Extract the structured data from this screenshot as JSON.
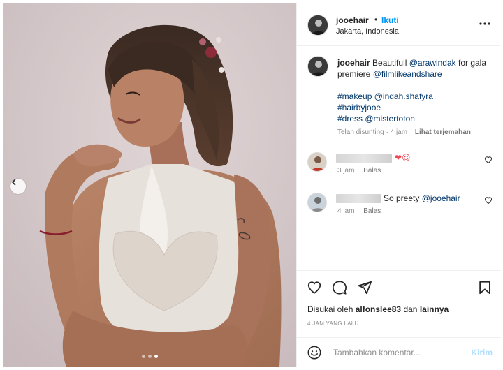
{
  "post": {
    "username": "jooehair",
    "separator": "•",
    "follow_label": "Ikuti",
    "location": "Jakarta, Indonesia",
    "more_icon": "more-horizontal-icon"
  },
  "caption": {
    "username": "jooehair",
    "text_1": "Beautifull",
    "mention_1": "@arawindak",
    "text_2": "for gala premiere",
    "mention_2": "@filmlikeandshare",
    "hashtag_makeup": "#makeup",
    "mention_makeup": "@indah.shafyra",
    "hashtag_hair": "#hairbyjooe",
    "hashtag_dress": "#dress",
    "mention_dress": "@mistertoton",
    "edited_label": "Telah disunting",
    "time_separator": "·",
    "time": "4 jam",
    "see_translation": "Lihat terjemahan"
  },
  "comments": [
    {
      "text": "",
      "emoji": "❤😍",
      "time": "3 jam",
      "reply_label": "Balas"
    },
    {
      "text": "So preety",
      "mention": "@jooehair",
      "time": "4 jam",
      "reply_label": "Balas"
    }
  ],
  "likes": {
    "prefix": "Disukai oleh",
    "user": "alfonslee83",
    "connector": "dan",
    "others": "lainnya"
  },
  "timestamp": "4 JAM YANG LALU",
  "add_comment": {
    "placeholder": "Tambahkan komentar...",
    "post_label": "Kirim"
  },
  "carousel": {
    "total_slides": 3,
    "active_slide": 3
  },
  "colors": {
    "link": "#00376b",
    "follow": "#0095f6",
    "post_disabled": "#b2dffc",
    "heart": "#ed4956",
    "muted": "#8e8e8e"
  }
}
